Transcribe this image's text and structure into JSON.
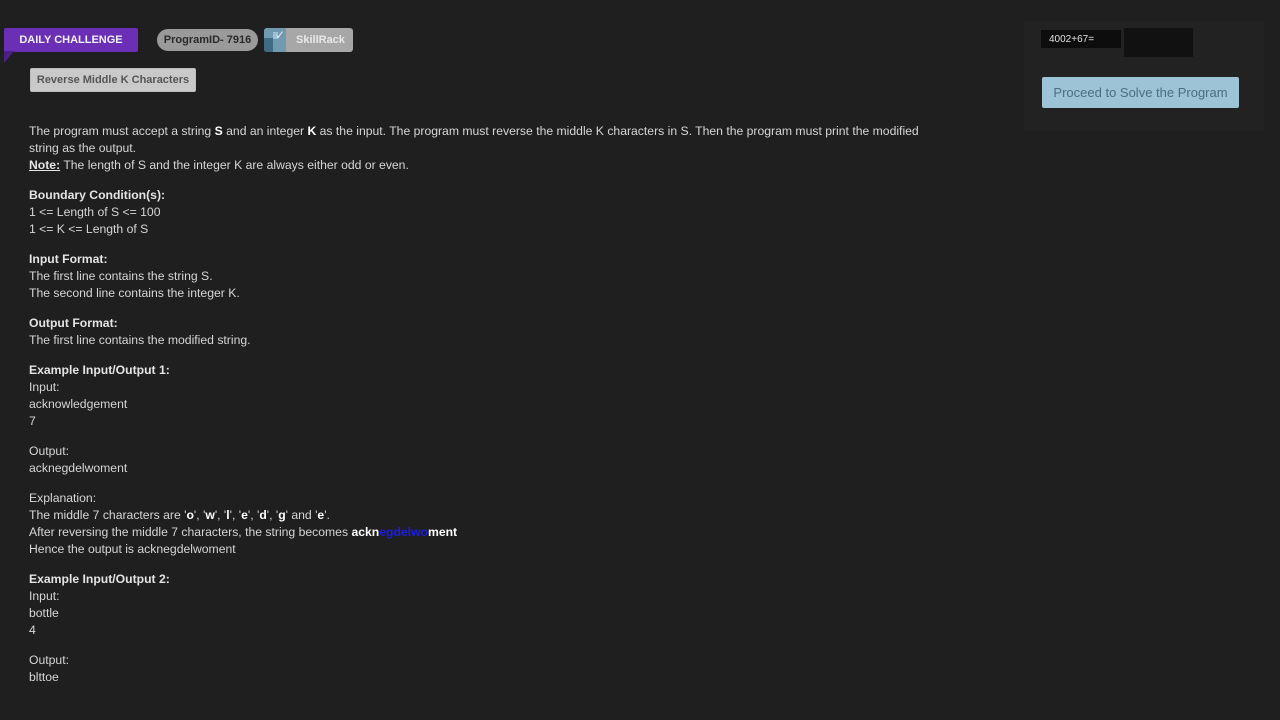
{
  "header": {
    "daily_badge": "DAILY CHALLENGE",
    "program_id": "ProgramID- 7916",
    "brand": "SkillRack",
    "brand_icon": "skillrack-logo-icon",
    "problem_title": "Reverse Middle K Characters"
  },
  "side": {
    "captcha": "4002+67=",
    "captcha_value": "",
    "proceed_label": "Proceed to Solve the Program"
  },
  "problem": {
    "intro_1_a": "The program must accept a string ",
    "intro_1_s": "S",
    "intro_1_b": " and an integer ",
    "intro_1_k": "K",
    "intro_1_c": " as the input. The program must reverse the middle K characters in S. Then the program must print the modified",
    "intro_2": "string as the output.",
    "note_label": "Note:",
    "note_text": " The length of S and the integer K are always either odd or even.",
    "boundary_heading": "Boundary Condition(s):",
    "boundary_1": "1 <= Length of S <= 100",
    "boundary_2": "1 <= K <= Length of S",
    "input_format_heading": "Input Format:",
    "input_format_1": "The first line contains the string S.",
    "input_format_2": "The second line contains the integer K.",
    "output_format_heading": "Output Format:",
    "output_format_1": "The first line contains the modified string.",
    "example1_heading": "Example Input/Output 1:",
    "example1_input_label": "Input:",
    "example1_input_1": "acknowledgement",
    "example1_input_2": "7",
    "example1_output_label": "Output:",
    "example1_output": "acknegdelwoment",
    "explanation_label": "Explanation:",
    "explanation_1_a": "The middle 7 characters are '",
    "explanation_1_c1": "o",
    "explanation_1_s1": "', '",
    "explanation_1_c2": "w",
    "explanation_1_s2": "', '",
    "explanation_1_c3": "l",
    "explanation_1_s3": "', '",
    "explanation_1_c4": "e",
    "explanation_1_s4": "', '",
    "explanation_1_c5": "d",
    "explanation_1_s5": "', '",
    "explanation_1_c6": "g",
    "explanation_1_s6": "' and '",
    "explanation_1_c7": "e",
    "explanation_1_end": "'.",
    "explanation_2_a": "After reversing the middle 7 characters, the string becomes ",
    "explanation_2_b1": "ackn",
    "explanation_2_hl": "egdelwo",
    "explanation_2_b2": "ment",
    "explanation_3": "Hence the output is acknegdelwoment",
    "example2_heading": "Example Input/Output 2:",
    "example2_input_label": "Input:",
    "example2_input_1": "bottle",
    "example2_input_2": "4",
    "example2_output_label": "Output:",
    "example2_output": "blttoe"
  },
  "colors": {
    "background": "#1f1f1f",
    "daily_badge": "#6a2fb5",
    "proceed_button": "#9cc3d6",
    "highlight": "#1c1ce0"
  }
}
